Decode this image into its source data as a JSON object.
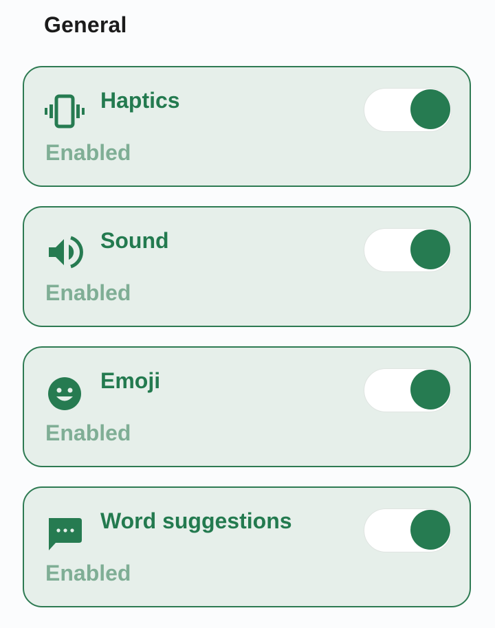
{
  "section": {
    "title": "General"
  },
  "colors": {
    "accent": "#267b51",
    "card_border": "#2d7a52",
    "card_bg": "#e6efea",
    "status_text": "#7fae95",
    "toggle_track": "#ffffff"
  },
  "settings": [
    {
      "icon": "vibration-icon",
      "title": "Haptics",
      "status": "Enabled",
      "enabled": true
    },
    {
      "icon": "volume-icon",
      "title": "Sound",
      "status": "Enabled",
      "enabled": true
    },
    {
      "icon": "emoji-icon",
      "title": "Emoji",
      "status": "Enabled",
      "enabled": true
    },
    {
      "icon": "chat-bubble-icon",
      "title": "Word suggestions",
      "status": "Enabled",
      "enabled": true
    }
  ]
}
